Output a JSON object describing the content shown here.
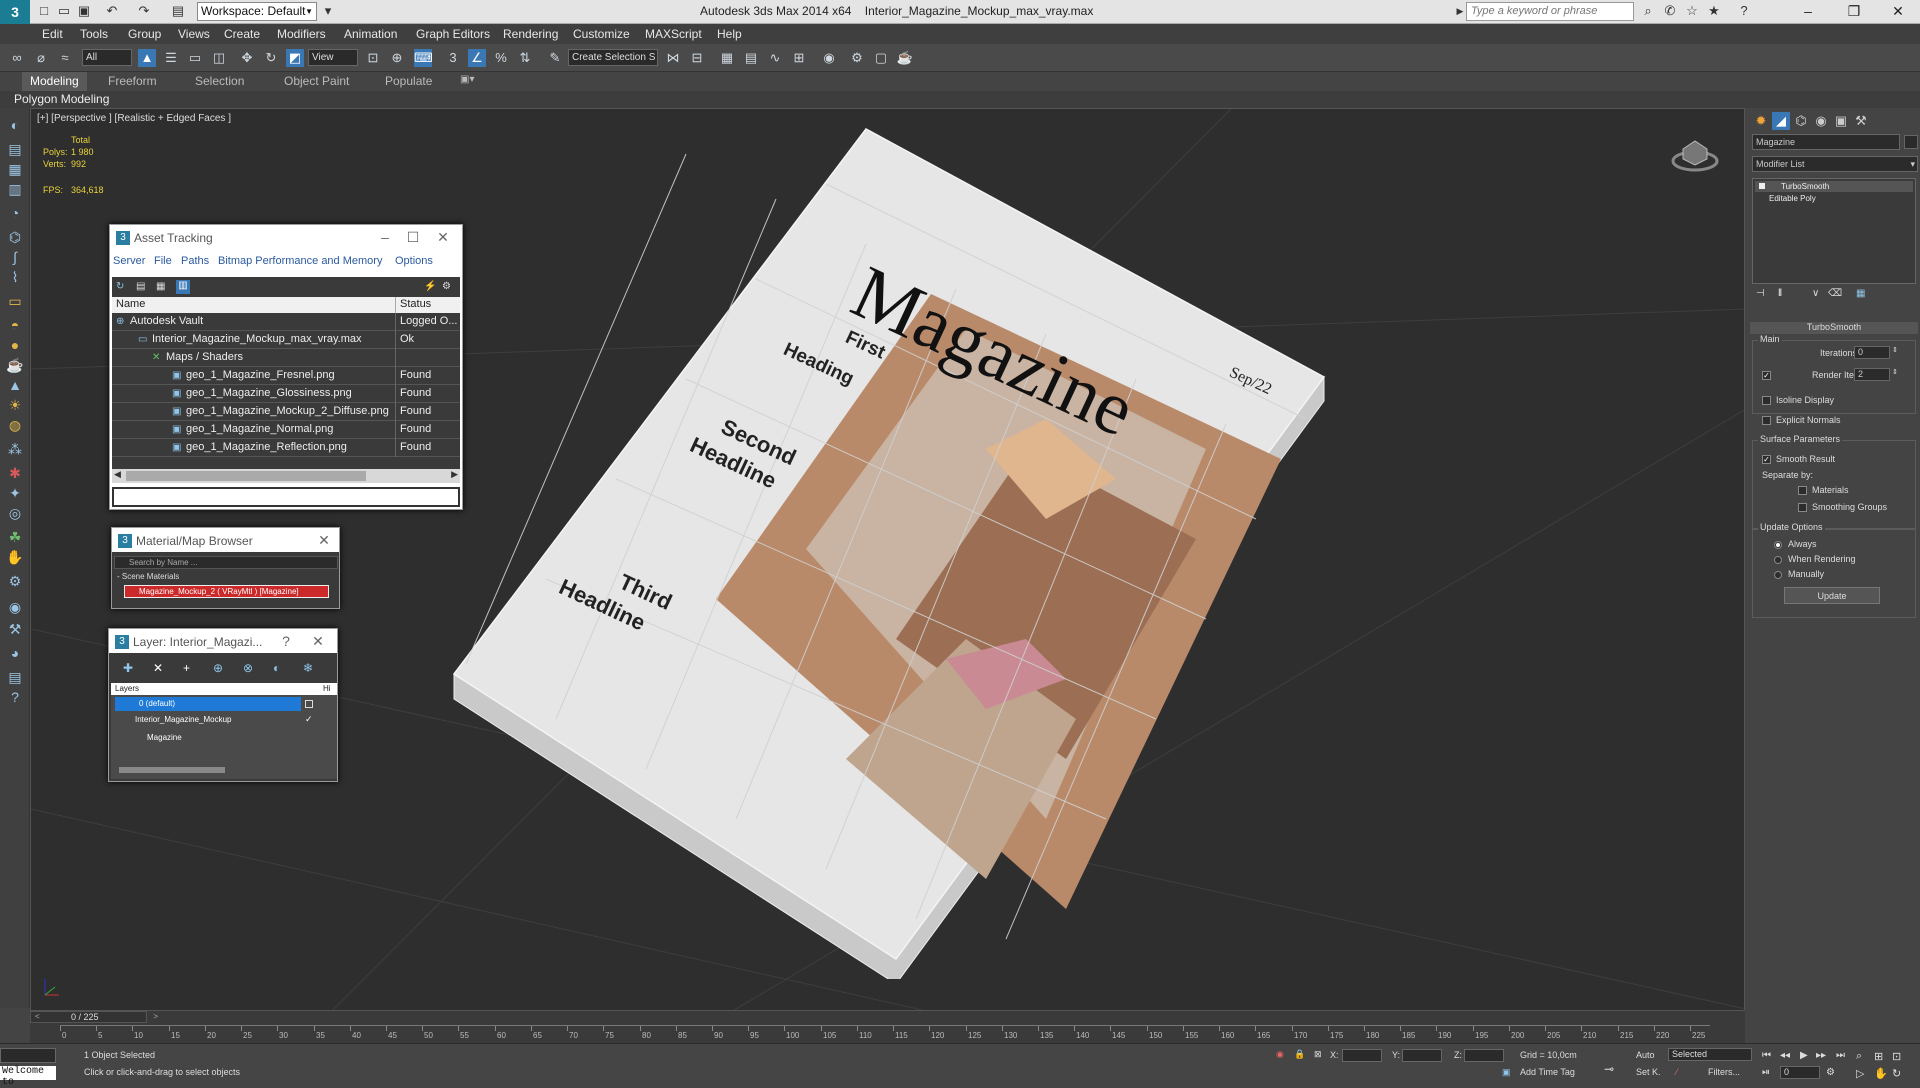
{
  "titlebar": {
    "workspace": "Workspace: Default",
    "app_title": "Autodesk 3ds Max  2014 x64",
    "file_name": "Interior_Magazine_Mockup_max_vray.max",
    "help_placeholder": "Type a keyword or phrase"
  },
  "menu": [
    "Edit",
    "Tools",
    "Group",
    "Views",
    "Create",
    "Modifiers",
    "Animation",
    "Graph Editors",
    "Rendering",
    "Customize",
    "MAXScript",
    "Help"
  ],
  "toolbar": {
    "filter": "All",
    "ref_coord": "View",
    "named_selection": "Create Selection S"
  },
  "ribbon": {
    "tabs": [
      "Modeling",
      "Freeform",
      "Selection",
      "Object Paint",
      "Populate"
    ],
    "active_tab": "Modeling",
    "panel_label": "Polygon Modeling"
  },
  "viewport": {
    "label": "[+] [Perspective ] [Realistic + Edged Faces ]",
    "stats": {
      "total_label": "Total",
      "polys_label": "Polys:",
      "polys_value": "1 980",
      "verts_label": "Verts:",
      "verts_value": "992",
      "fps_label": "FPS:",
      "fps_value": "364,618"
    },
    "magazine": {
      "title": "Magazine",
      "date": "Sep/22",
      "headline1_line1": "First",
      "headline1_line2": "Heading",
      "headline2_line1": "Second",
      "headline2_line2": "Headline",
      "headline3_line1": "Third",
      "headline3_line2": "Headline"
    }
  },
  "asset_tracking": {
    "title": "Asset Tracking",
    "menu": [
      "Server",
      "File",
      "Paths",
      "Bitmap Performance and Memory",
      "Options"
    ],
    "col_name": "Name",
    "col_status": "Status",
    "rows": [
      {
        "name": "Autodesk Vault",
        "status": "Logged O..."
      },
      {
        "name": "Interior_Magazine_Mockup_max_vray.max",
        "status": "Ok"
      },
      {
        "name": "Maps / Shaders",
        "status": ""
      },
      {
        "name": "geo_1_Magazine_Fresnel.png",
        "status": "Found"
      },
      {
        "name": "geo_1_Magazine_Glossiness.png",
        "status": "Found"
      },
      {
        "name": "geo_1_Magazine_Mockup_2_Diffuse.png",
        "status": "Found"
      },
      {
        "name": "geo_1_Magazine_Normal.png",
        "status": "Found"
      },
      {
        "name": "geo_1_Magazine_Reflection.png",
        "status": "Found"
      }
    ]
  },
  "material_browser": {
    "title": "Material/Map Browser",
    "search_placeholder": "Search by Name ...",
    "section": "- Scene Materials",
    "item": "Magazine_Mockup_2 ( VRayMtl ) [Magazine]"
  },
  "layer_manager": {
    "title": "Layer: Interior_Magazi...",
    "help": "?",
    "col_layers": "Layers",
    "col_h": "Hi",
    "rows": [
      {
        "name": "0 (default)"
      },
      {
        "name": "Interior_Magazine_Mockup"
      },
      {
        "name": "Magazine"
      }
    ]
  },
  "command_panel": {
    "object_name": "Magazine",
    "modifier_list": "Modifier List",
    "stack": [
      "TurboSmooth",
      "Editable Poly"
    ],
    "rollout_title": "TurboSmooth",
    "main_label": "Main",
    "iterations_label": "Iterations:",
    "iterations_value": "0",
    "render_iters_label": "Render Iters:",
    "render_iters_value": "2",
    "render_iters_checked": true,
    "isoline_label": "Isoline Display",
    "explicit_normals_label": "Explicit Normals",
    "surface_params_label": "Surface Parameters",
    "smooth_result_label": "Smooth Result",
    "separate_by_label": "Separate by:",
    "materials_label": "Materials",
    "smoothing_groups_label": "Smoothing Groups",
    "update_options_label": "Update Options",
    "always_label": "Always",
    "when_rendering_label": "When Rendering",
    "manually_label": "Manually",
    "update_button": "Update"
  },
  "timeline": {
    "frame": "0 / 225",
    "ticks": [
      "0",
      "5",
      "10",
      "15",
      "20",
      "25",
      "30",
      "35",
      "40",
      "45",
      "50",
      "55",
      "60",
      "65",
      "70",
      "75",
      "80",
      "85",
      "90",
      "95",
      "100",
      "105",
      "110",
      "115",
      "120",
      "125",
      "130",
      "135",
      "140",
      "145",
      "150",
      "155",
      "160",
      "165",
      "170",
      "175",
      "180",
      "185",
      "190",
      "195",
      "200",
      "205",
      "210",
      "215",
      "220",
      "225"
    ]
  },
  "status": {
    "welcome": "Welcome to",
    "selection": "1 Object Selected",
    "prompt": "Click or click-and-drag to select objects",
    "x_label": "X:",
    "y_label": "Y:",
    "z_label": "Z:",
    "grid": "Grid = 10,0cm",
    "add_time_tag": "Add Time Tag",
    "auto": "Auto",
    "set_k": "Set K.",
    "selected": "Selected",
    "filters": "Filters...",
    "frame_value": "0"
  }
}
